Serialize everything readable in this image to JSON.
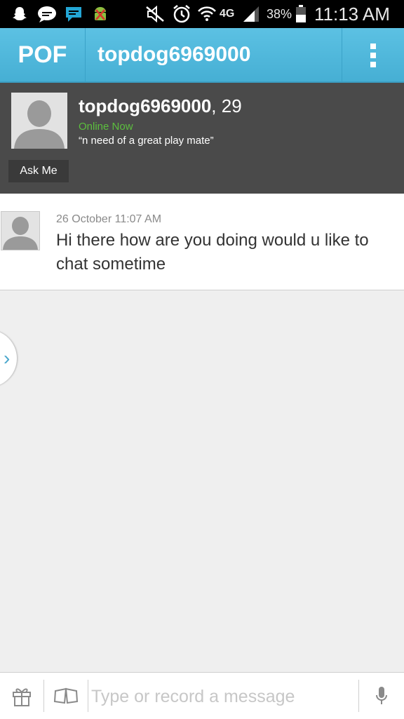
{
  "status_bar": {
    "battery": "38%",
    "time": "11:13 AM",
    "network": "4G",
    "icons": [
      "snapchat-icon",
      "chat-bubble-icon",
      "message-icon",
      "android-icon",
      "mute-icon",
      "alarm-icon",
      "wifi-icon",
      "signal-icon",
      "battery-icon"
    ]
  },
  "app_bar": {
    "logo": "POF",
    "title": "topdog6969000",
    "menu_icon": "overflow-menu-icon"
  },
  "profile": {
    "username": "topdog6969000",
    "age_suffix": ", 29",
    "online_status": "Online Now",
    "headline": "“n need of a great play mate”",
    "ask_me_label": "Ask Me"
  },
  "messages": [
    {
      "timestamp": "26 October 11:07 AM",
      "text": "Hi there how are you doing would u like to chat sometime"
    }
  ],
  "composer": {
    "placeholder": "Type or record a message"
  },
  "colors": {
    "app_bar": "#4fb8dc",
    "online": "#5cbf3e",
    "profile_bg": "#4a4a4a"
  }
}
